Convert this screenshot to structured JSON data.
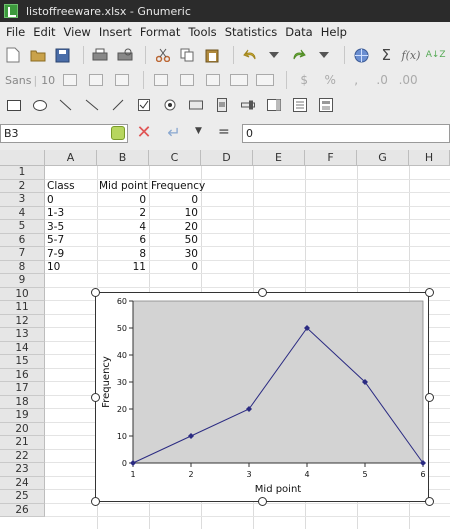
{
  "window": {
    "title": "listoffreeware.xlsx - Gnumeric"
  },
  "menu": [
    "File",
    "Edit",
    "View",
    "Insert",
    "Format",
    "Tools",
    "Statistics",
    "Data",
    "Help"
  ],
  "format_toolbar": {
    "font_name": "Sans",
    "font_size": "10"
  },
  "formula_bar": {
    "cell_ref": "B3",
    "equals": "=",
    "value": "0"
  },
  "columns": [
    "A",
    "B",
    "C",
    "D",
    "E",
    "F",
    "G",
    "H"
  ],
  "rows": [
    "1",
    "2",
    "3",
    "4",
    "5",
    "6",
    "7",
    "8",
    "9",
    "10",
    "11",
    "12",
    "13",
    "14",
    "15",
    "16",
    "17",
    "18",
    "19",
    "20",
    "21",
    "22",
    "23",
    "24",
    "25",
    "26"
  ],
  "table": {
    "headers": [
      "Class",
      "Mid point",
      "Frequency"
    ],
    "rows": [
      [
        "0",
        "0",
        "0"
      ],
      [
        "1-3",
        "2",
        "10"
      ],
      [
        "3-5",
        "4",
        "20"
      ],
      [
        "5-7",
        "6",
        "50"
      ],
      [
        "7-9",
        "8",
        "30"
      ],
      [
        "10",
        "11",
        "0"
      ]
    ]
  },
  "chart_data": {
    "type": "line",
    "x": [
      1,
      2,
      3,
      4,
      5,
      6
    ],
    "values": [
      0,
      10,
      20,
      50,
      30,
      0
    ],
    "xlabel": "Mid point",
    "ylabel": "Frequency",
    "ylim": [
      0,
      60
    ],
    "yticks": [
      0,
      10,
      20,
      30,
      40,
      50,
      60
    ],
    "xticks": [
      1,
      2,
      3,
      4,
      5,
      6
    ],
    "plot_background": "#d3d3d3",
    "line_color": "#2b2b82"
  }
}
